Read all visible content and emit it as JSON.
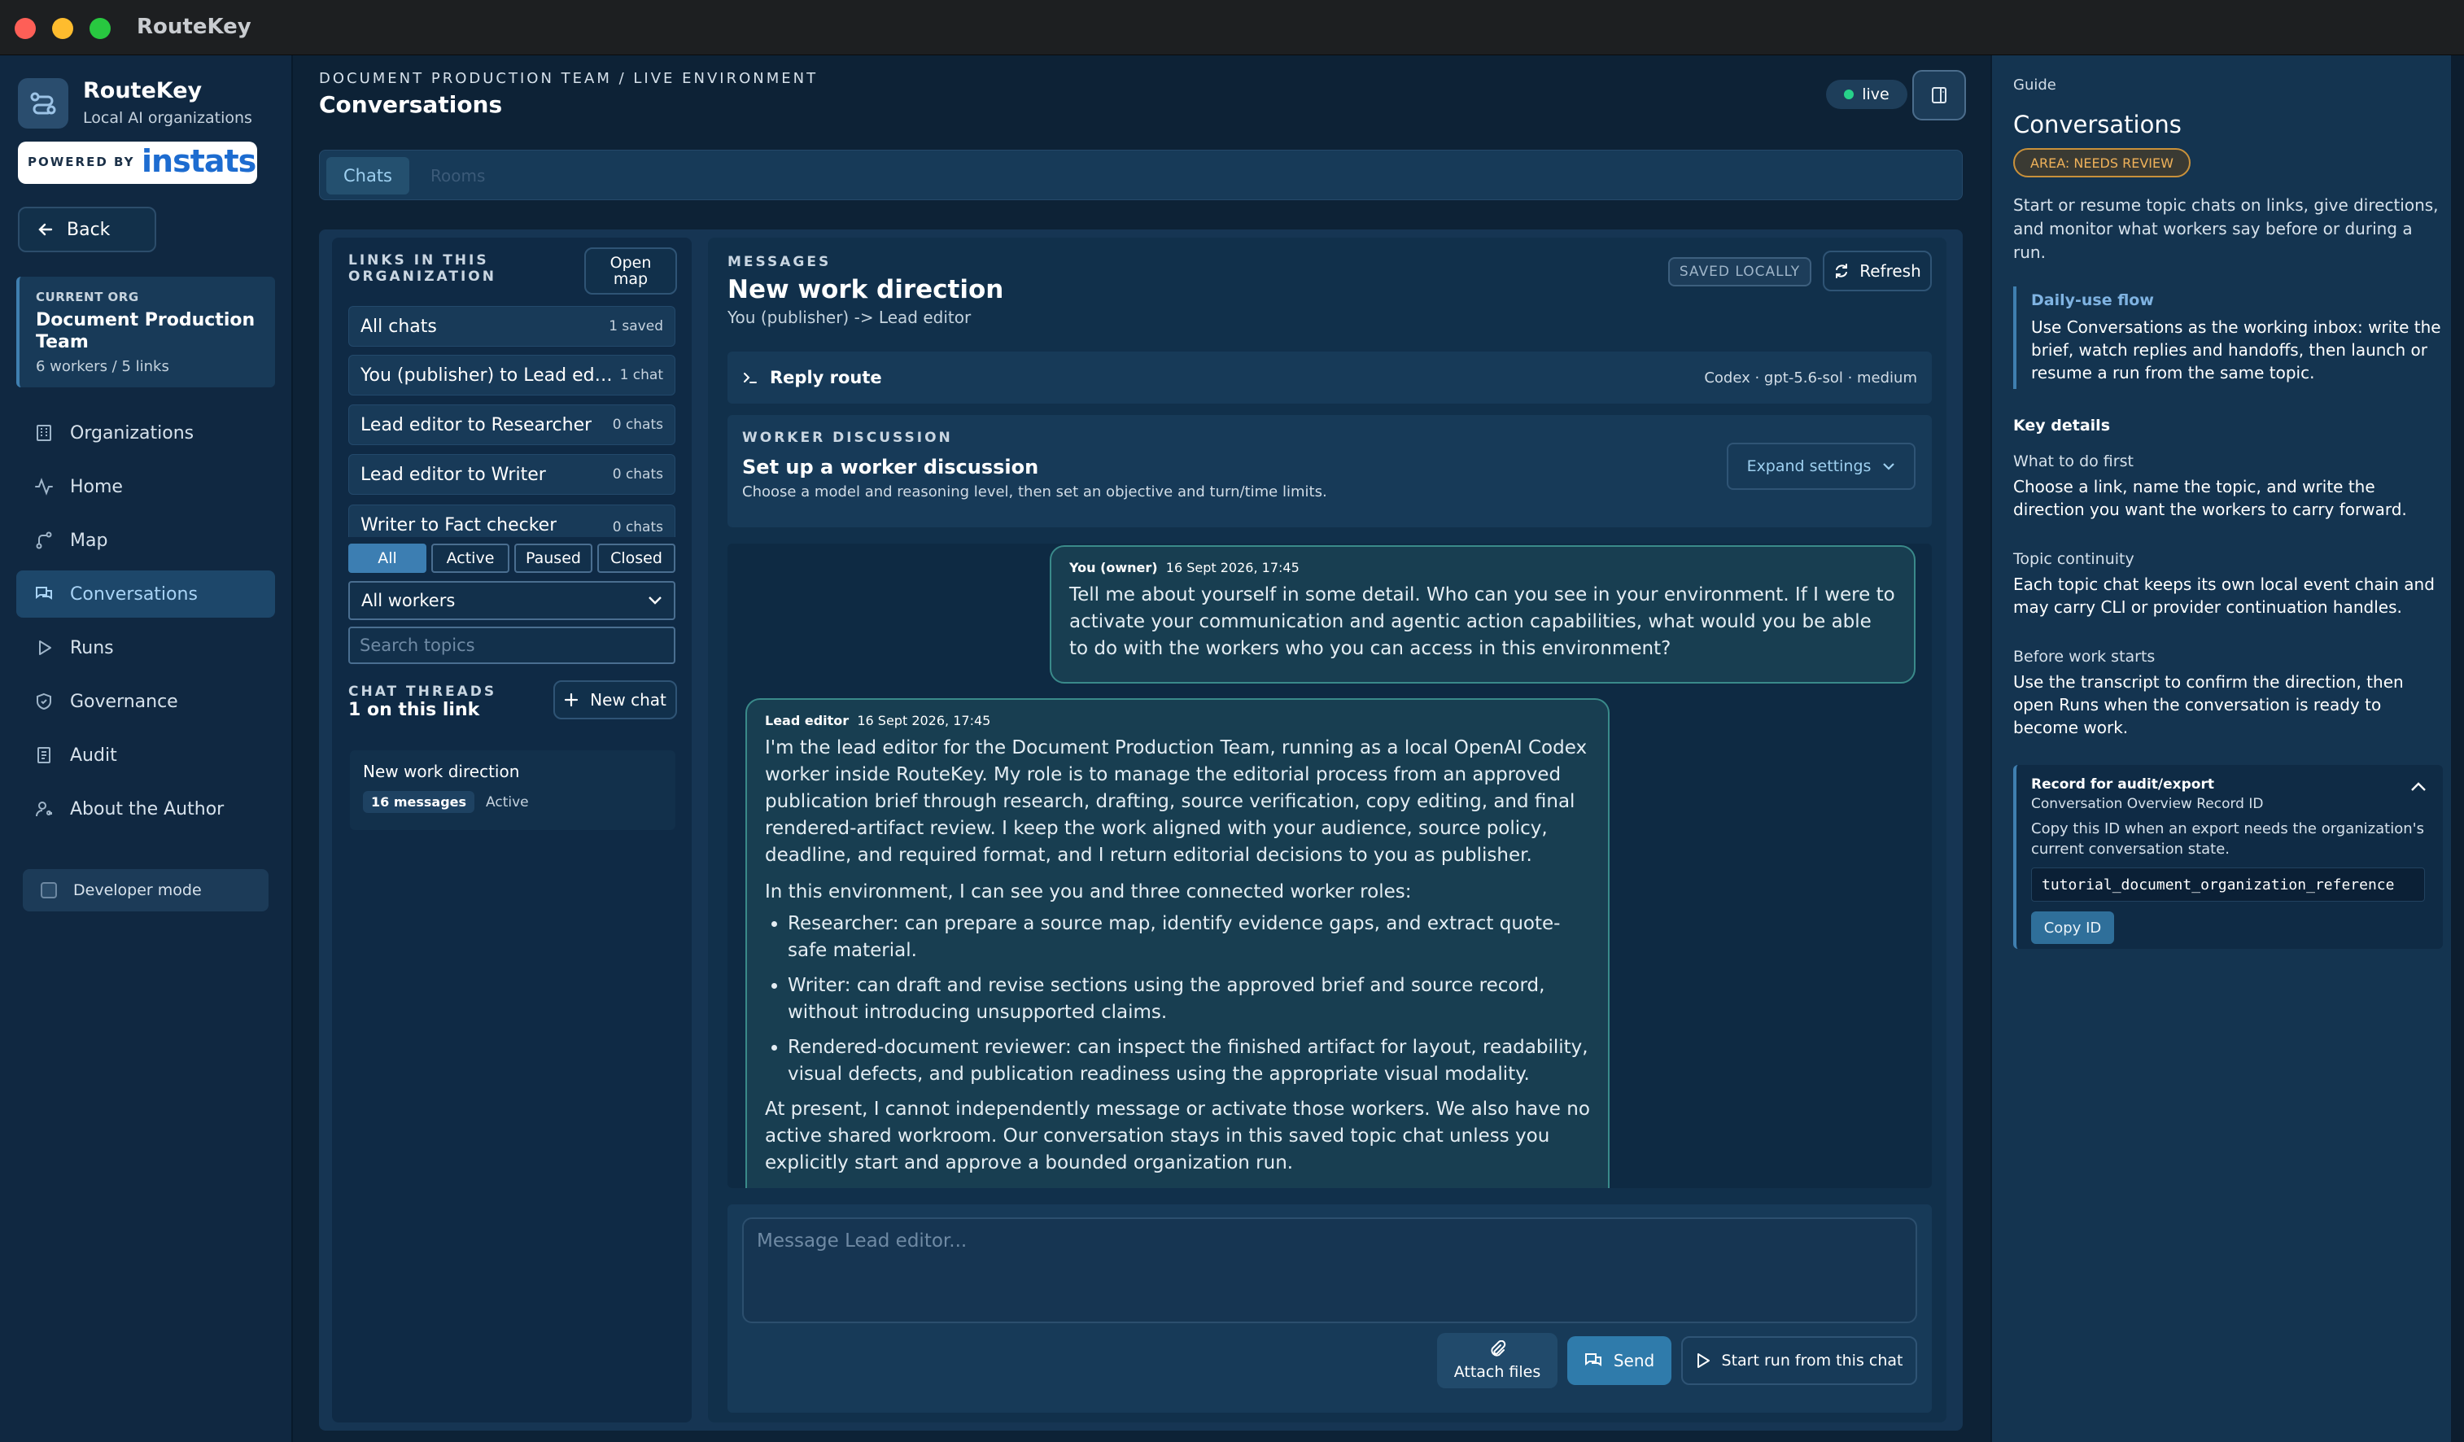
{
  "window": {
    "title": "RouteKey"
  },
  "colors": {
    "close": "#fe5f57",
    "minimize": "#febc2e",
    "zoom": "#28c840",
    "accent": "#3c7eb2",
    "live": "#27d28a",
    "warning": "#f0b25a"
  },
  "sidebar": {
    "brand_name": "RouteKey",
    "brand_sub": "Local AI organizations",
    "powered_prefix": "POWERED BY",
    "powered_brand": "instats",
    "back_label": "Back",
    "org_label": "CURRENT ORG",
    "org_name": "Document Production Team",
    "org_stats": "6 workers / 5 links",
    "nav": [
      {
        "label": "Organizations",
        "icon": "building-icon"
      },
      {
        "label": "Home",
        "icon": "activity-icon"
      },
      {
        "label": "Map",
        "icon": "route-icon"
      },
      {
        "label": "Conversations",
        "icon": "chat-icon",
        "active": true
      },
      {
        "label": "Runs",
        "icon": "play-icon"
      },
      {
        "label": "Governance",
        "icon": "shield-icon"
      },
      {
        "label": "Audit",
        "icon": "document-icon"
      },
      {
        "label": "About the Author",
        "icon": "user-key-icon"
      }
    ],
    "dev_mode_label": "Developer mode"
  },
  "header": {
    "breadcrumb": "DOCUMENT PRODUCTION TEAM / LIVE ENVIRONMENT",
    "title": "Conversations",
    "status": "live"
  },
  "tabs": [
    {
      "label": "Chats",
      "active": true
    },
    {
      "label": "Rooms",
      "active": false
    }
  ],
  "links": {
    "label_line1": "LINKS IN THIS",
    "label_line2": "ORGANIZATION",
    "open_map_line1": "Open",
    "open_map_line2": "map",
    "items": [
      {
        "name": "All chats",
        "count": "1 saved"
      },
      {
        "name": "You (publisher) to Lead editor",
        "count": "1 chat"
      },
      {
        "name": "Lead editor to Researcher",
        "count": "0 chats"
      },
      {
        "name": "Lead editor to Writer",
        "count": "0 chats"
      },
      {
        "name": "Writer to Fact checker",
        "count": "0 chats"
      }
    ],
    "filters": [
      "All",
      "Active",
      "Paused",
      "Closed"
    ],
    "workers_select": "All workers",
    "search_placeholder": "Search topics",
    "threads_label": "CHAT THREADS",
    "threads_count": "1 on this link",
    "new_chat_label": "New chat",
    "thread": {
      "title": "New work direction",
      "messages": "16 messages",
      "status": "Active"
    }
  },
  "messages": {
    "label": "MESSAGES",
    "title": "New work direction",
    "subtitle": "You (publisher) -> Lead editor",
    "saved_badge": "SAVED LOCALLY",
    "refresh_label": "Refresh",
    "reply_route_label": "Reply route",
    "reply_route_value": "Codex · gpt-5.6-sol · medium",
    "worker_label": "WORKER DISCUSSION",
    "worker_title": "Set up a worker discussion",
    "worker_sub": "Choose a model and reasoning level, then set an objective and turn/time limits.",
    "expand_label": "Expand settings",
    "owner_msg": {
      "author": "You (owner)",
      "time": "16 Sept 2026, 17:45",
      "text": "Tell me about yourself in some detail. Who can you see in your environment. If I were to activate your communication and agentic action capabilities, what would you be able to do with the workers who you can access in this environment?"
    },
    "editor_msg": {
      "author": "Lead editor",
      "time": "16 Sept 2026, 17:45",
      "p1": "I'm the lead editor for the Document Production Team, running as a local OpenAI Codex worker inside RouteKey. My role is to manage the editorial process from an approved publication brief through research, drafting, source verification, copy editing, and final rendered-artifact review. I keep the work aligned with your audience, source policy, deadline, and required format, and I return editorial decisions to you as publisher.",
      "p2": "In this environment, I can see you and three connected worker roles:",
      "bullets": [
        "Researcher: can prepare a source map, identify evidence gaps, and extract quote-safe material.",
        "Writer: can draft and revise sections using the approved brief and source record, without introducing unsupported claims.",
        "Rendered-document reviewer: can inspect the finished artifact for layout, readability, visual defects, and publication readiness using the appropriate visual modality."
      ],
      "p3": "At present, I cannot independently message or activate those workers. We also have no active shared workroom. Our conversation stays in this saved topic chat unless you explicitly start and approve a bounded organization run."
    },
    "composer_placeholder": "Message Lead editor...",
    "attach_label": "Attach files",
    "send_label": "Send",
    "start_run_label": "Start run from this chat"
  },
  "guide": {
    "label": "Guide",
    "title": "Conversations",
    "area_badge": "AREA: NEEDS REVIEW",
    "intro": "Start or resume topic chats on links, give directions, and monitor what workers say before or during a run.",
    "flow_title": "Daily-use flow",
    "flow_body": "Use Conversations as the working inbox: write the brief, watch replies and handoffs, then launch or resume a run from the same topic.",
    "key_details": "Key details",
    "sections": [
      {
        "title": "What to do first",
        "body": "Choose a link, name the topic, and write the direction you want the workers to carry forward."
      },
      {
        "title": "Topic continuity",
        "body": "Each topic chat keeps its own local event chain and may carry CLI or provider continuation handles."
      },
      {
        "title": "Before work starts",
        "body": "Use the transcript to confirm the direction, then open Runs when the conversation is ready to become work."
      }
    ],
    "record_title": "Record for audit/export",
    "record_sub": "Conversation Overview Record ID",
    "record_desc": "Copy this ID when an export needs the organization's current conversation state.",
    "record_id": "tutorial_document_organization_reference",
    "copy_label": "Copy ID"
  }
}
